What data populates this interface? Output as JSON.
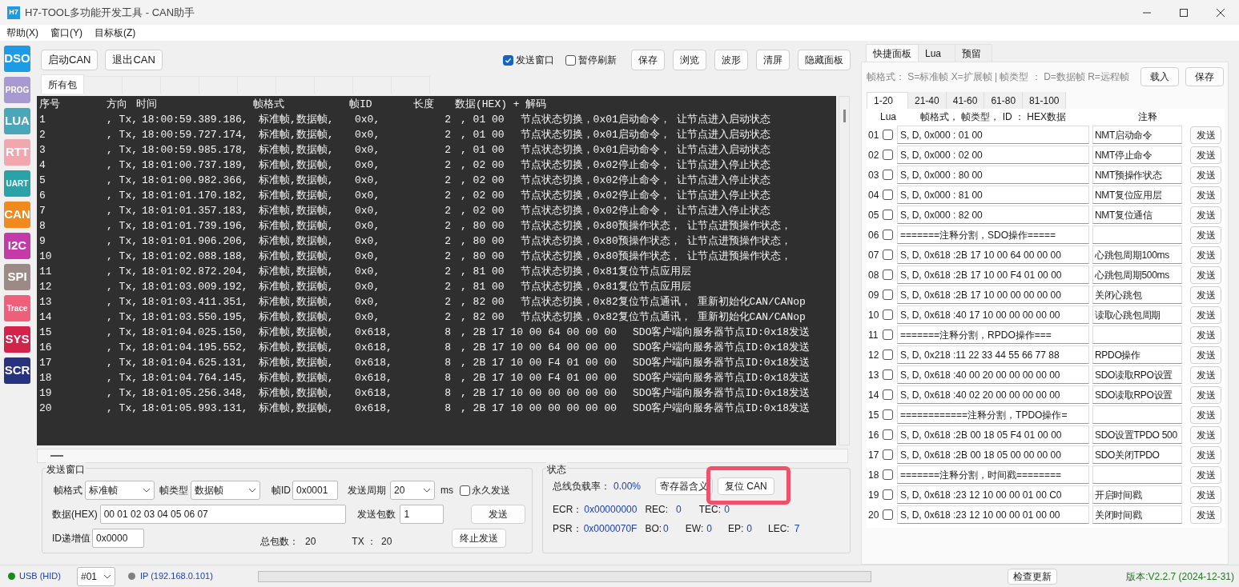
{
  "window": {
    "logo": "H7",
    "title": "H7-TOOL多功能开发工具 - CAN助手"
  },
  "menu": [
    "帮助(X)",
    "窗口(Y)",
    "目标板(Z)"
  ],
  "sidebar": [
    {
      "label": "DSO",
      "color": "#1e9be6"
    },
    {
      "label": "PROG",
      "color": "#a89ad0"
    },
    {
      "label": "LUA",
      "color": "#4aa7b8"
    },
    {
      "label": "RTT",
      "color": "#f2a7ae"
    },
    {
      "label": "UART",
      "color": "#29a3a8"
    },
    {
      "label": "CAN",
      "color": "#f08a1c"
    },
    {
      "label": "I2C",
      "color": "#c33aa8"
    },
    {
      "label": "SPI",
      "color": "#9c8a86"
    },
    {
      "label": "Trace",
      "color": "#ee5f7a"
    },
    {
      "label": "SYS",
      "color": "#d2234a"
    },
    {
      "label": "SCR",
      "color": "#27337f"
    }
  ],
  "toolbar": {
    "left_buttons": [
      "启动CAN",
      "退出CAN"
    ],
    "checks": [
      {
        "label": "发送窗口",
        "checked": true
      },
      {
        "label": "暂停刷新",
        "checked": false
      }
    ],
    "right_buttons": [
      "保存",
      "浏览",
      "波形",
      "清屏",
      "隐藏面板"
    ]
  },
  "log_tabs": [
    {
      "label": "所有包",
      "selected": true
    }
  ],
  "log": {
    "header": [
      "序号",
      "方向",
      "时间",
      "帧格式",
      "帧ID",
      "长度",
      "数据(HEX) + 解码"
    ],
    "rows": [
      {
        "seq": "1",
        "dir": ", Tx,",
        "time": "18:00:59.389.186,",
        "format": "标准帧,数据帧,",
        "id": "0x0,",
        "length": "2",
        "data": ", 01 00",
        "decode": "节点状态切换，0x01启动命令， 让节点进入启动状态"
      },
      {
        "seq": "2",
        "dir": ", Tx,",
        "time": "18:00:59.727.174,",
        "format": "标准帧,数据帧,",
        "id": "0x0,",
        "length": "2",
        "data": ", 01 00",
        "decode": "节点状态切换，0x01启动命令， 让节点进入启动状态"
      },
      {
        "seq": "3",
        "dir": ", Tx,",
        "time": "18:00:59.985.178,",
        "format": "标准帧,数据帧,",
        "id": "0x0,",
        "length": "2",
        "data": ", 01 00",
        "decode": "节点状态切换，0x01启动命令， 让节点进入启动状态"
      },
      {
        "seq": "4",
        "dir": ", Tx,",
        "time": "18:01:00.737.189,",
        "format": "标准帧,数据帧,",
        "id": "0x0,",
        "length": "2",
        "data": ", 02 00",
        "decode": "节点状态切换，0x02停止命令， 让节点进入停止状态"
      },
      {
        "seq": "5",
        "dir": ", Tx,",
        "time": "18:01:00.982.366,",
        "format": "标准帧,数据帧,",
        "id": "0x0,",
        "length": "2",
        "data": ", 02 00",
        "decode": "节点状态切换，0x02停止命令， 让节点进入停止状态"
      },
      {
        "seq": "6",
        "dir": ", Tx,",
        "time": "18:01:01.170.182,",
        "format": "标准帧,数据帧,",
        "id": "0x0,",
        "length": "2",
        "data": ", 02 00",
        "decode": "节点状态切换，0x02停止命令， 让节点进入停止状态"
      },
      {
        "seq": "7",
        "dir": ", Tx,",
        "time": "18:01:01.357.183,",
        "format": "标准帧,数据帧,",
        "id": "0x0,",
        "length": "2",
        "data": ", 02 00",
        "decode": "节点状态切换，0x02停止命令， 让节点进入停止状态"
      },
      {
        "seq": "8",
        "dir": ", Tx,",
        "time": "18:01:01.739.196,",
        "format": "标准帧,数据帧,",
        "id": "0x0,",
        "length": "2",
        "data": ", 80 00",
        "decode": "节点状态切换，0x80预操作状态， 让节点进预操作状态，"
      },
      {
        "seq": "9",
        "dir": ", Tx,",
        "time": "18:01:01.906.206,",
        "format": "标准帧,数据帧,",
        "id": "0x0,",
        "length": "2",
        "data": ", 80 00",
        "decode": "节点状态切换，0x80预操作状态， 让节点进预操作状态，"
      },
      {
        "seq": "10",
        "dir": ", Tx,",
        "time": "18:01:02.088.188,",
        "format": "标准帧,数据帧,",
        "id": "0x0,",
        "length": "2",
        "data": ", 80 00",
        "decode": "节点状态切换，0x80预操作状态， 让节点进预操作状态，"
      },
      {
        "seq": "11",
        "dir": ", Tx,",
        "time": "18:01:02.872.204,",
        "format": "标准帧,数据帧,",
        "id": "0x0,",
        "length": "2",
        "data": ", 81 00",
        "decode": "节点状态切换，0x81复位节点应用层"
      },
      {
        "seq": "12",
        "dir": ", Tx,",
        "time": "18:01:03.009.192,",
        "format": "标准帧,数据帧,",
        "id": "0x0,",
        "length": "2",
        "data": ", 81 00",
        "decode": "节点状态切换，0x81复位节点应用层"
      },
      {
        "seq": "13",
        "dir": ", Tx,",
        "time": "18:01:03.411.351,",
        "format": "标准帧,数据帧,",
        "id": "0x0,",
        "length": "2",
        "data": ", 82 00",
        "decode": "节点状态切换，0x82复位节点通讯， 重新初始化CAN/CANop"
      },
      {
        "seq": "14",
        "dir": ", Tx,",
        "time": "18:01:03.550.195,",
        "format": "标准帧,数据帧,",
        "id": "0x0,",
        "length": "2",
        "data": ", 82 00",
        "decode": "节点状态切换，0x82复位节点通讯， 重新初始化CAN/CANop"
      },
      {
        "seq": "15",
        "dir": ", Tx,",
        "time": "18:01:04.025.150,",
        "format": "标准帧,数据帧,",
        "id": "0x618,",
        "length": "8",
        "data": ", 2B 17 10 00 64 00 00 00",
        "decode": "SDO客户端向服务器节点ID:0x18发送"
      },
      {
        "seq": "16",
        "dir": ", Tx,",
        "time": "18:01:04.195.552,",
        "format": "标准帧,数据帧,",
        "id": "0x618,",
        "length": "8",
        "data": ", 2B 17 10 00 64 00 00 00",
        "decode": "SDO客户端向服务器节点ID:0x18发送"
      },
      {
        "seq": "17",
        "dir": ", Tx,",
        "time": "18:01:04.625.131,",
        "format": "标准帧,数据帧,",
        "id": "0x618,",
        "length": "8",
        "data": ", 2B 17 10 00 F4 01 00 00",
        "decode": "SDO客户端向服务器节点ID:0x18发送"
      },
      {
        "seq": "18",
        "dir": ", Tx,",
        "time": "18:01:04.764.145,",
        "format": "标准帧,数据帧,",
        "id": "0x618,",
        "length": "8",
        "data": ", 2B 17 10 00 F4 01 00 00",
        "decode": "SDO客户端向服务器节点ID:0x18发送"
      },
      {
        "seq": "19",
        "dir": ", Tx,",
        "time": "18:01:05.256.348,",
        "format": "标准帧,数据帧,",
        "id": "0x618,",
        "length": "8",
        "data": ", 2B 17 10 00 00 00 00 00",
        "decode": "SDO客户端向服务器节点ID:0x18发送"
      },
      {
        "seq": "20",
        "dir": ", Tx,",
        "time": "18:01:05.993.131,",
        "format": "标准帧,数据帧,",
        "id": "0x618,",
        "length": "8",
        "data": ", 2B 17 10 00 00 00 00 00",
        "decode": "SDO客户端向服务器节点ID:0x18发送"
      }
    ]
  },
  "send_window": {
    "title": "发送窗口",
    "frame_format_label": "帧格式",
    "frame_format": "标准帧",
    "frame_type_label": "帧类型",
    "frame_type": "数据帧",
    "frame_id_label": "帧ID",
    "frame_id": "0x0001",
    "period_label": "发送周期",
    "period": "20",
    "period_unit": "ms",
    "forever": {
      "label": "永久发送",
      "checked": false
    },
    "data_label": "数据(HEX)",
    "data": "00 01 02 03 04 05 06 07",
    "count_label": "发送包数",
    "count": "1",
    "send_button": "发送",
    "id_step_label": "ID递增值",
    "id_step": "0x0000",
    "total_label": "总包数：",
    "total": "20",
    "tx_label": "TX ：",
    "tx": "20",
    "stop_button": "终止发送"
  },
  "status": {
    "title": "状态",
    "load_label": "总线负载率：",
    "load": "0.00%",
    "register_button": "寄存器含义",
    "reset_button": {
      "label": "复位 CAN",
      "highlighted": true
    },
    "ecr_label": "ECR：",
    "ecr": "0x00000000",
    "rec_label": "REC:",
    "rec": "0",
    "tec_label": "TEC:",
    "tec": "0",
    "psr_label": "PSR：",
    "psr": "0x0000070F",
    "bo_label": "BO:",
    "bo": "0",
    "ew_label": "EW:",
    "ew": "0",
    "ep_label": "EP:",
    "ep": "0",
    "lec_label": "LEC:",
    "lec": "7"
  },
  "panel": {
    "tabs": [
      {
        "label": "快捷面板",
        "selected": true
      },
      {
        "label": "Lua",
        "selected": false
      },
      {
        "label": "预留",
        "selected": false
      }
    ],
    "legend": "帧格式： S=标准帧 X=扩展帧 | 帧类型 ： D=数据帧 R=远程帧",
    "buttons": [
      "载入",
      "保存"
    ],
    "pages": [
      {
        "label": "1-20",
        "selected": true
      },
      {
        "label": "21-40",
        "selected": false
      },
      {
        "label": "41-60",
        "selected": false
      },
      {
        "label": "61-80",
        "selected": false
      },
      {
        "label": "81-100",
        "selected": false
      }
    ],
    "columns": [
      "Lua",
      "帧格式， 帧类型， ID ： HEX数据",
      "注释"
    ],
    "rows": [
      {
        "num": "01",
        "checked": false,
        "frame": "S, D, 0x000 : 01 00",
        "note": "NMT启动命令",
        "button": "发送"
      },
      {
        "num": "02",
        "checked": false,
        "frame": "S, D, 0x000 : 02 00",
        "note": "NMT停止命令",
        "button": "发送"
      },
      {
        "num": "03",
        "checked": false,
        "frame": "S, D, 0x000 : 80 00",
        "note": "NMT预操作状态",
        "button": "发送"
      },
      {
        "num": "04",
        "checked": false,
        "frame": "S, D, 0x000 : 81 00",
        "note": "NMT复位应用层",
        "button": "发送"
      },
      {
        "num": "05",
        "checked": false,
        "frame": "S, D, 0x000 : 82 00",
        "note": "NMT复位通信",
        "button": "发送"
      },
      {
        "num": "06",
        "checked": false,
        "frame": "=======注释分割，SDO操作=====",
        "button": "发送"
      },
      {
        "num": "07",
        "checked": false,
        "frame": "S, D, 0x618 :2B 17 10 00 64 00 00 00",
        "note": "心跳包周期100ms",
        "button": "发送"
      },
      {
        "num": "08",
        "checked": false,
        "frame": "S, D, 0x618 :2B 17 10 00 F4 01 00 00",
        "note": "心跳包周期500ms",
        "button": "发送"
      },
      {
        "num": "09",
        "checked": false,
        "frame": "S, D, 0x618 :2B 17 10 00 00 00 00 00",
        "note": "关闭心跳包",
        "button": "发送"
      },
      {
        "num": "10",
        "checked": false,
        "frame": "S, D, 0x618 :40 17 10 00 00 00 00 00",
        "note": "读取心跳包周期",
        "button": "发送"
      },
      {
        "num": "11",
        "checked": false,
        "frame": "=======注释分割，RPDO操作===",
        "button": "发送"
      },
      {
        "num": "12",
        "checked": false,
        "frame": "S, D, 0x218 :11 22 33 44 55 66 77 88",
        "note": "RPDO操作",
        "button": "发送"
      },
      {
        "num": "13",
        "checked": false,
        "frame": "S, D, 0x618 :40 00 20 00 00 00 00 00",
        "note": "SDO读取RPO设置",
        "button": "发送"
      },
      {
        "num": "14",
        "checked": false,
        "frame": "S, D, 0x618 :40 02 20 00 00 00 00 00",
        "note": "SDO读取RPO设置",
        "button": "发送"
      },
      {
        "num": "15",
        "checked": false,
        "frame": "============注释分割，TPDO操作=",
        "button": "发送"
      },
      {
        "num": "16",
        "checked": false,
        "frame": "S, D, 0x618 :2B 00 18 05 F4 01 00 00",
        "note": "SDO设置TPDO 500",
        "button": "发送"
      },
      {
        "num": "17",
        "checked": false,
        "frame": "S, D, 0x618 :2B 00 18 05 00 00 00 00",
        "note": "SDO关闭TPDO",
        "button": "发送"
      },
      {
        "num": "18",
        "checked": false,
        "frame": "=======注释分割，时间戳========",
        "button": "发送"
      },
      {
        "num": "19",
        "checked": false,
        "frame": "S, D, 0x618 :23 12 10 00 00 01 00 C0",
        "note": "开启时间戳",
        "button": "发送"
      },
      {
        "num": "20",
        "checked": false,
        "frame": "S, D, 0x618 :23 12 10 00 00 01 00 00",
        "note": "关闭时间戳",
        "button": "发送"
      }
    ]
  },
  "status_bar": {
    "progress": {
      "level": 0
    },
    "usb": {
      "label": "USB (HID)",
      "connected": true
    },
    "device": "#01",
    "ip": {
      "label": "IP (192.168.0.101)",
      "connected": false
    },
    "update_button": "检查更新",
    "version": "版本:V2.2.7 (2024-12-31)"
  }
}
